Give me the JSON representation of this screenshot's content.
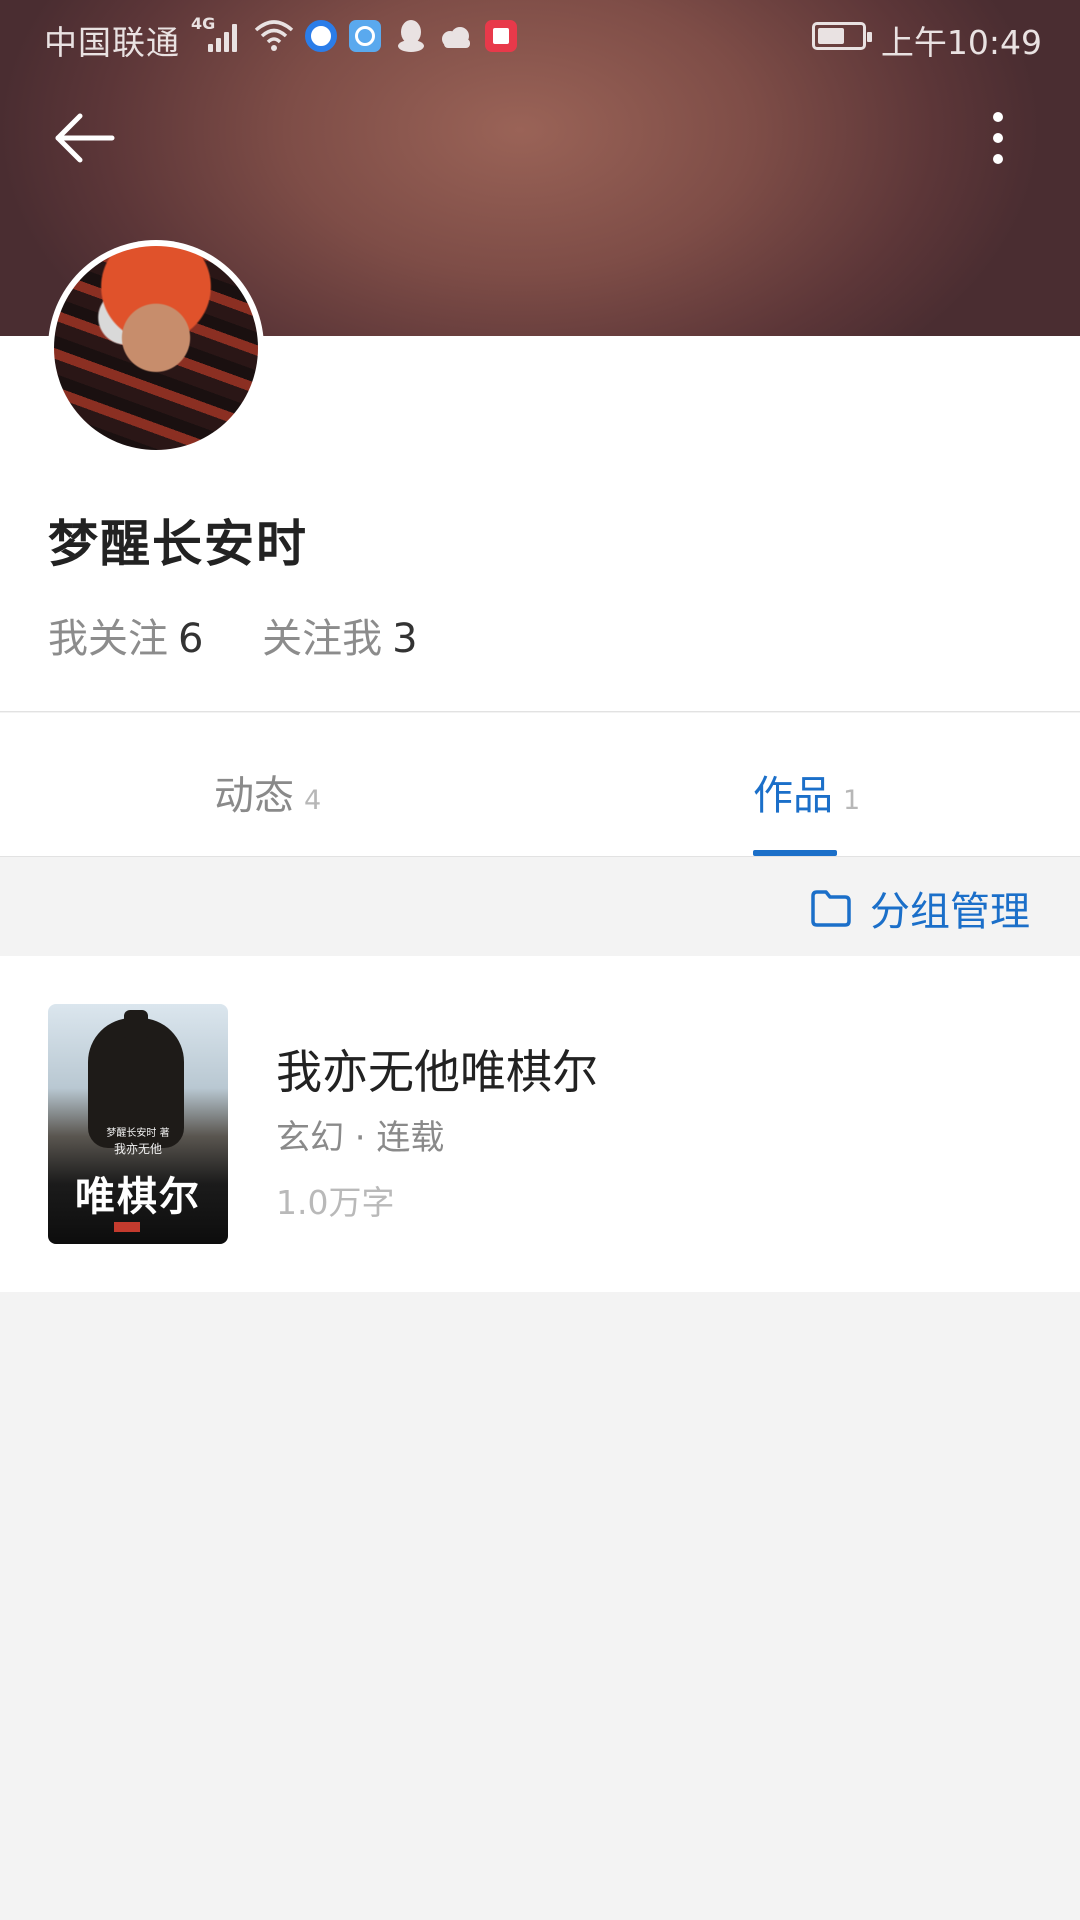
{
  "status_bar": {
    "carrier": "中国联通",
    "network": "4G",
    "time": "上午10:49"
  },
  "header": {
    "back_icon": "arrow-left-icon",
    "more_icon": "more-vertical-icon",
    "banner_color": "#8a5550"
  },
  "profile": {
    "name": "梦醒长安时",
    "following_label": "我关注",
    "following_count": "6",
    "followers_label": "关注我",
    "followers_count": "3"
  },
  "tabs": [
    {
      "label": "动态",
      "count": "4",
      "active": false
    },
    {
      "label": "作品",
      "count": "1",
      "active": true
    }
  ],
  "group_manage": {
    "icon": "folder-icon",
    "label": "分组管理"
  },
  "works": [
    {
      "title": "我亦无他唯棋尔",
      "genre_status": "玄幻 · 连载",
      "word_count": "1.0万字",
      "cover": {
        "author_line": "梦醒长安时 著",
        "subtitle": "我亦无他",
        "title": "唯棋尔"
      }
    }
  ],
  "colors": {
    "accent": "#1b6fc9",
    "background": "#f3f3f3"
  }
}
